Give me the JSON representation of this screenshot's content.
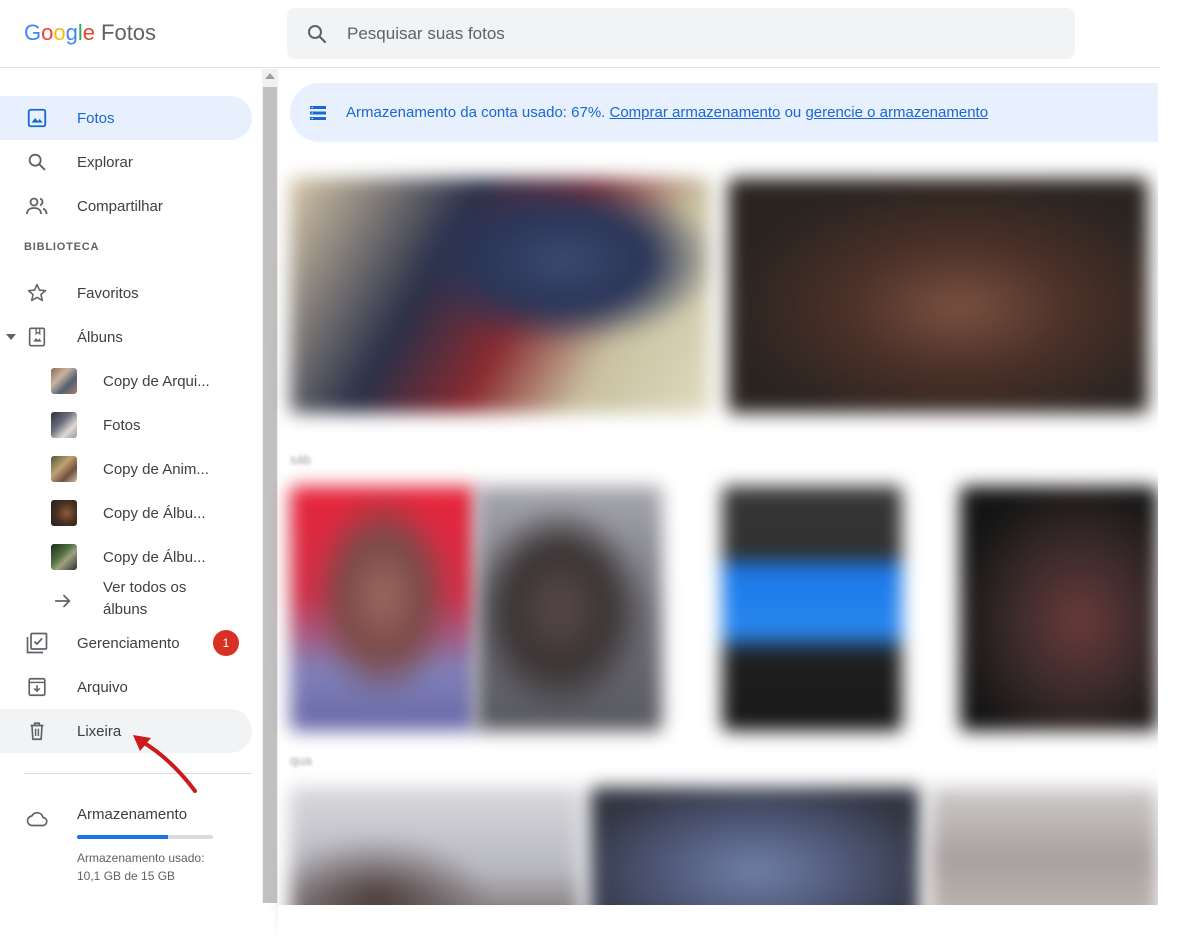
{
  "app": {
    "logo_google": "Google",
    "logo_product": "Fotos"
  },
  "search": {
    "placeholder": "Pesquisar suas fotos"
  },
  "sidebar": {
    "items": [
      {
        "label": "Fotos",
        "icon": "photo-icon"
      },
      {
        "label": "Explorar",
        "icon": "search-icon"
      },
      {
        "label": "Compartilhar",
        "icon": "people-icon"
      }
    ],
    "library_label": "BIBLIOTECA",
    "library": [
      {
        "label": "Favoritos",
        "icon": "star-icon"
      },
      {
        "label": "Álbuns",
        "icon": "album-icon"
      }
    ],
    "albums": [
      {
        "label": "Copy de Arqui..."
      },
      {
        "label": "Fotos"
      },
      {
        "label": "Copy de Anim..."
      },
      {
        "label": "Copy de Álbu..."
      },
      {
        "label": "Copy de Álbu..."
      }
    ],
    "see_all_albums": "Ver todos os álbuns",
    "bottom": [
      {
        "label": "Gerenciamento",
        "icon": "manage-icon",
        "badge": "1"
      },
      {
        "label": "Arquivo",
        "icon": "archive-icon"
      },
      {
        "label": "Lixeira",
        "icon": "trash-icon"
      }
    ],
    "storage": {
      "title": "Armazenamento",
      "text": "Armazenamento usado: 10,1 GB de 15 GB",
      "used_fraction": 0.67
    }
  },
  "banner": {
    "prefix": "Armazenamento da conta usado: 67%. ",
    "link1": "Comprar armazenamento",
    "middle": " ou ",
    "link2": "gerencie o armazenamento"
  },
  "groups": {
    "label2": "sáb",
    "label3": "qua"
  },
  "colors": {
    "accent": "#1a73e8",
    "active_bg": "#e8f0fe",
    "badge": "#d93025",
    "annotation": "#cc1a1a"
  }
}
